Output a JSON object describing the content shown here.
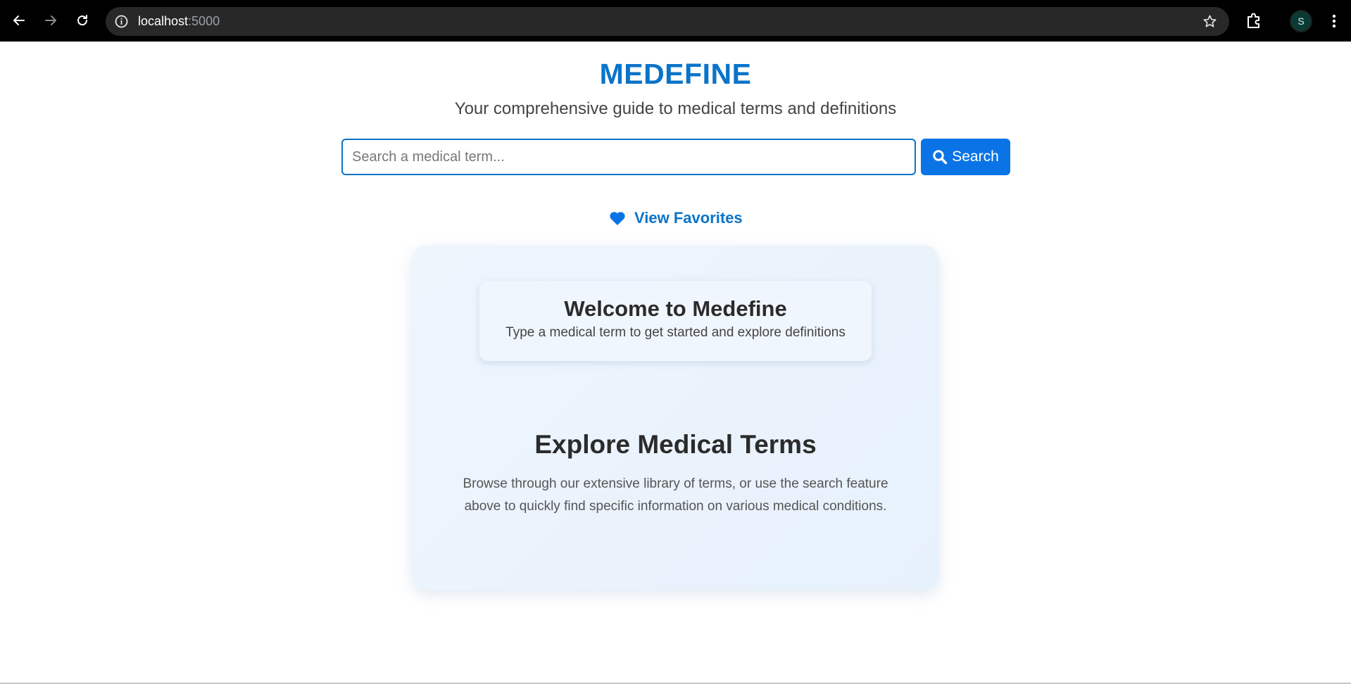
{
  "browser": {
    "url_host": "localhost",
    "url_port": ":5000",
    "profile_initial": "S",
    "icons": {
      "back": "arrow-left-icon",
      "forward": "arrow-right-icon",
      "reload": "reload-icon",
      "info": "info-icon",
      "bookmark": "star-icon",
      "extensions": "puzzle-icon",
      "menu": "kebab-menu-icon"
    }
  },
  "header": {
    "title": "MEDEFINE",
    "tagline": "Your comprehensive guide to medical terms and definitions"
  },
  "search": {
    "placeholder": "Search a medical term...",
    "value": "",
    "button_label": "Search",
    "button_icon": "magnifier-icon"
  },
  "favorites": {
    "label": "View Favorites",
    "icon": "heart-icon"
  },
  "welcome": {
    "title": "Welcome to Medefine",
    "subtitle": "Type a medical term to get started and explore definitions"
  },
  "explore": {
    "title": "Explore Medical Terms",
    "text": "Browse through our extensive library of terms, or use the search feature above to quickly find specific information on various medical conditions."
  },
  "colors": {
    "brand": "#0a74c9",
    "button": "#0a74e6",
    "card_background": "#eef5fd"
  }
}
